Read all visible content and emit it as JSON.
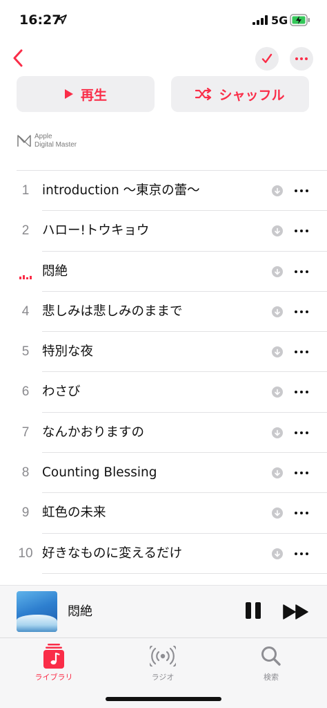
{
  "status_bar": {
    "time": "16:27",
    "network": "5G",
    "icons": [
      "location-arrow-icon",
      "signal-bars-icon",
      "battery-charging-icon"
    ]
  },
  "nav": {
    "back_icon": "chevron-left-icon",
    "check_icon": "checkmark-icon",
    "more_icon": "ellipsis-icon"
  },
  "actions": {
    "play_label": "再生",
    "shuffle_label": "シャッフル"
  },
  "badge": {
    "line1": "Apple",
    "line2": "Digital Master"
  },
  "tracks": [
    {
      "number": "1",
      "title": "introduction 〜東京の蕾〜"
    },
    {
      "number": "2",
      "title": "ハロー!トウキョウ"
    },
    {
      "number": "",
      "title": "悶絶",
      "now_playing": true
    },
    {
      "number": "4",
      "title": "悲しみは悲しみのままで"
    },
    {
      "number": "5",
      "title": "特別な夜"
    },
    {
      "number": "6",
      "title": "わさび"
    },
    {
      "number": "7",
      "title": "なんかおりますの"
    },
    {
      "number": "8",
      "title": "Counting Blessing"
    },
    {
      "number": "9",
      "title": "虹色の未来"
    },
    {
      "number": "10",
      "title": "好きなものに変えるだけ"
    }
  ],
  "mini_player": {
    "title": "悶絶"
  },
  "tabs": [
    {
      "label": "ライブラリ",
      "icon": "music-note-library-icon",
      "active": true
    },
    {
      "label": "ラジオ",
      "icon": "radio-waves-icon",
      "active": false
    },
    {
      "label": "検索",
      "icon": "search-icon",
      "active": false
    }
  ],
  "colors": {
    "accent": "#fa2d48",
    "secondary_text": "#8a8a8e",
    "button_bg": "#efeff1"
  }
}
